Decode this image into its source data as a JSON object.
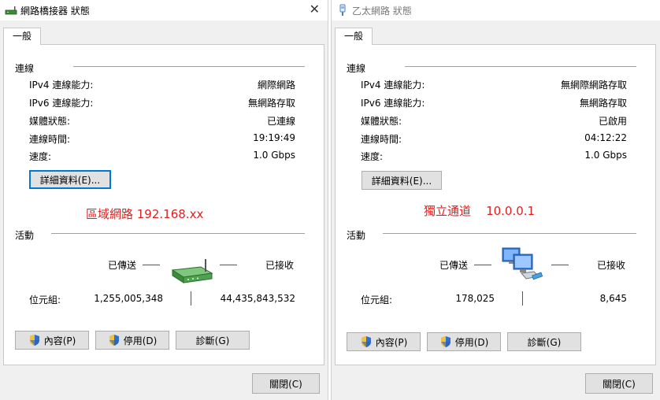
{
  "left": {
    "title": "網路橋接器 狀態",
    "close_glyph": "✕",
    "tab": "一般",
    "connection_header": "連線",
    "rows": [
      {
        "label": "IPv4 連線能力:",
        "value": "網際網路"
      },
      {
        "label": "IPv6 連線能力:",
        "value": "無網路存取"
      },
      {
        "label": "媒體狀態:",
        "value": "已連線"
      },
      {
        "label": "連線時間:",
        "value": "19:19:49"
      },
      {
        "label": "速度:",
        "value": "1.0 Gbps"
      }
    ],
    "details_button": "詳細資料(E)...",
    "annotation": "區域網路 192.168.xx",
    "activity_header": "活動",
    "sent_label": "已傳送",
    "received_label": "已接收",
    "bytes_label": "位元組:",
    "bytes_sent": "1,255,005,348",
    "bytes_received": "44,435,843,532",
    "properties_button": "內容(P)",
    "disable_button": "停用(D)",
    "diagnose_button": "診斷(G)",
    "close_button": "關閉(C)"
  },
  "right": {
    "title": "乙太網路 狀態",
    "tab": "一般",
    "connection_header": "連線",
    "rows": [
      {
        "label": "IPv4 連線能力:",
        "value": "無網際網路存取"
      },
      {
        "label": "IPv6 連線能力:",
        "value": "無網路存取"
      },
      {
        "label": "媒體狀態:",
        "value": "已啟用"
      },
      {
        "label": "連線時間:",
        "value": "04:12:22"
      },
      {
        "label": "速度:",
        "value": "1.0 Gbps"
      }
    ],
    "details_button": "詳細資料(E)...",
    "annotation": "獨立通道    10.0.0.1",
    "activity_header": "活動",
    "sent_label": "已傳送",
    "received_label": "已接收",
    "bytes_label": "位元組:",
    "bytes_sent": "178,025",
    "bytes_received": "8,645",
    "properties_button": "內容(P)",
    "disable_button": "停用(D)",
    "diagnose_button": "診斷(G)",
    "close_button": "關閉(C)"
  },
  "colors": {
    "annotation": "#e02020",
    "focus_border": "#0078d7",
    "button_face": "#e1e1e1"
  },
  "icons": {
    "left_title": "network-bridge-icon",
    "right_title": "ethernet-plug-icon",
    "left_activity": "router-icon",
    "right_activity": "network-computers-icon",
    "buttons": "uac-shield-icon"
  }
}
